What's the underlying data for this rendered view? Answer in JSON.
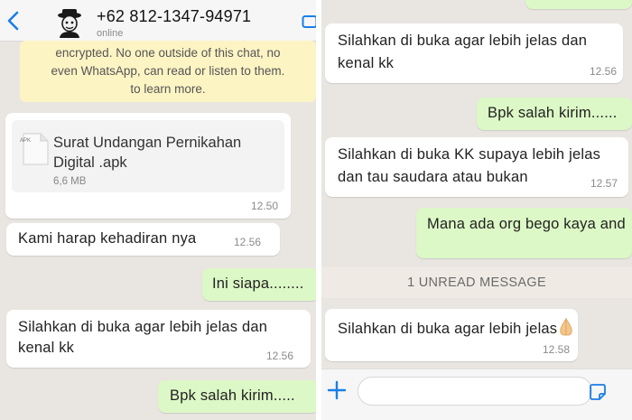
{
  "left": {
    "header": {
      "back_label": "",
      "contact_number": "+62 812-1347-94971",
      "status": "online"
    },
    "encryption_notice": [
      "encrypted. No one outside of this chat, no",
      "even WhatsApp, can read or listen to them.",
      "to learn more."
    ],
    "file_message": {
      "icon_label": "APK",
      "file_name_line1": "Surat Undangan Pernikahan",
      "file_name_line2": "Digital .apk",
      "file_size": "6,6 MB",
      "time": "12.50"
    },
    "messages": [
      {
        "text": "Kami harap kehadiran nya",
        "time": "12.56"
      },
      {
        "text": "Ini siapa........"
      },
      {
        "line1": "Silahkan di buka agar lebih jelas dan",
        "line2": "kenal kk",
        "time": "12.56"
      },
      {
        "text": "Bpk salah kirim....."
      }
    ]
  },
  "right": {
    "messages": [
      {
        "line1": "Silahkan di buka agar lebih jelas dan",
        "line2": "kenal kk",
        "time": "12.56"
      },
      {
        "text": "Bpk salah kirim......"
      },
      {
        "line1": "Silahkan di buka KK supaya lebih jelas",
        "line2": "dan tau saudara atau bukan",
        "time": "12.57"
      },
      {
        "text": "Mana ada org bego kaya and"
      },
      {
        "text": "Silahkan di buka agar lebih jelas",
        "time": "12.58"
      }
    ],
    "unread_divider": "1 UNREAD MESSAGE",
    "composer": {
      "placeholder": ""
    }
  },
  "colors": {
    "chat_background": "#e9e6e1",
    "incoming_bubble": "#ffffff",
    "outgoing_bubble": "#dcf8c6",
    "notice_background": "#fdf4c4",
    "accent_blue": "#1a7ee6"
  },
  "icons": [
    "chevron-left-icon",
    "avatar-icon",
    "video-call-icon",
    "apk-file-icon",
    "folded-hands-emoji",
    "plus-icon",
    "sticker-icon"
  ]
}
